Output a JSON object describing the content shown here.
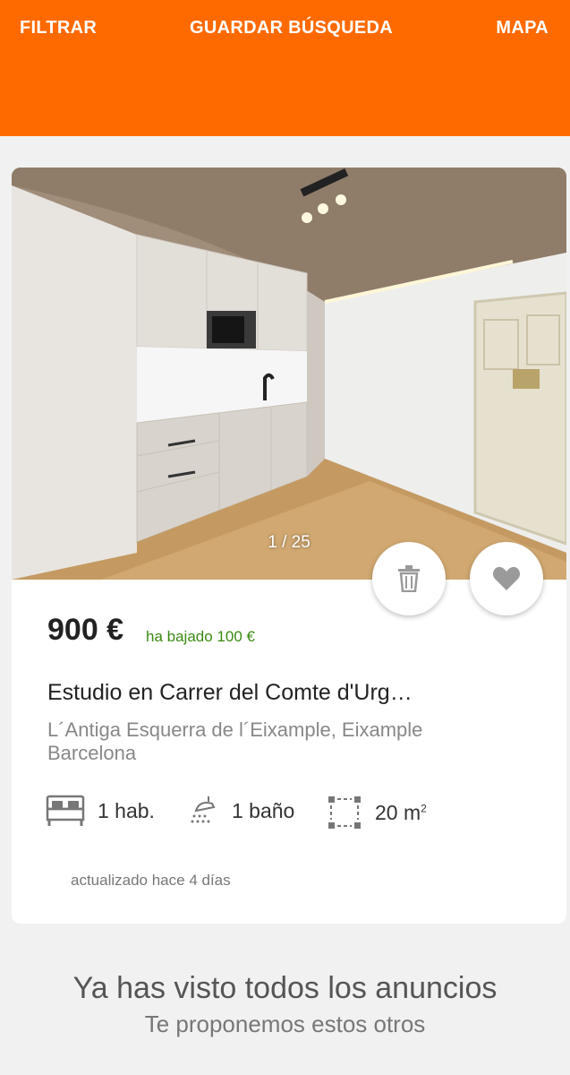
{
  "header": {
    "filter_label": "FILTRAR",
    "save_search_label": "GUARDAR BÚSQUEDA",
    "map_label": "MAPA",
    "background_color": "#ff6a00"
  },
  "listing": {
    "photo_counter": "1 / 25",
    "price": "900 €",
    "price_drop": "ha bajado 100 €",
    "title": "Estudio en Carrer del Comte d'Urg…",
    "location_line1": "L´Antiga Esquerra de l´Eixample, Eixample",
    "location_line2": "Barcelona",
    "rooms": "1 hab.",
    "bathrooms": "1 baño",
    "area": "20 m",
    "area_unit_sup": "2",
    "updated": "actualizado hace 4 días",
    "icons": [
      "trash-icon",
      "heart-icon",
      "bed-icon",
      "shower-icon",
      "area-icon"
    ],
    "price_drop_color": "#3a8a12"
  },
  "footer": {
    "seen_all": "Ya has visto todos los anuncios",
    "suggest": "Te proponemos estos otros"
  }
}
